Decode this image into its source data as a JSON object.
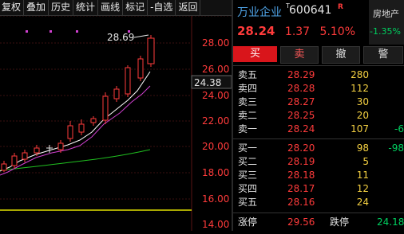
{
  "toolbar": {
    "items": [
      "复权",
      "叠加",
      "历史",
      "统计",
      "画线",
      "标记",
      "-自选",
      "返回"
    ]
  },
  "chart_data": {
    "type": "candlestick",
    "y_ticks": [
      "28.00",
      "26.00",
      "24.00",
      "22.00",
      "20.00",
      "18.00",
      "16.00",
      "14.00"
    ],
    "current_price_label": "24.38",
    "high_annotation": "28.69",
    "colors": {
      "up": "#ff3b3b",
      "down": "#00d060",
      "ma5": "#ffffff",
      "ma10": "#d040d0",
      "ma30": "#20c020",
      "hline": "#e0e000"
    }
  },
  "quote": {
    "name": "万业企业",
    "t_badge": "T",
    "code": "600641",
    "r_badge": "R",
    "sector": "房地产",
    "sector_change": "-1.35%",
    "price": "28.24",
    "change": "1.37",
    "change_pct": "5.10%"
  },
  "actions": {
    "buy": "买",
    "sell": "卖",
    "cancel": "撤",
    "alert": "警"
  },
  "asks": [
    {
      "label": "卖五",
      "price": "28.29",
      "volume": "280",
      "chg": ""
    },
    {
      "label": "卖四",
      "price": "28.28",
      "volume": "112",
      "chg": ""
    },
    {
      "label": "卖三",
      "price": "28.27",
      "volume": "30",
      "chg": ""
    },
    {
      "label": "卖二",
      "price": "28.25",
      "volume": "20",
      "chg": ""
    },
    {
      "label": "卖一",
      "price": "28.24",
      "volume": "107",
      "chg": "-6"
    }
  ],
  "bids": [
    {
      "label": "买一",
      "price": "28.20",
      "volume": "98",
      "chg": "-98"
    },
    {
      "label": "买二",
      "price": "28.19",
      "volume": "5",
      "chg": ""
    },
    {
      "label": "买三",
      "price": "28.18",
      "volume": "11",
      "chg": ""
    },
    {
      "label": "买四",
      "price": "28.17",
      "volume": "12",
      "chg": ""
    },
    {
      "label": "买五",
      "price": "28.16",
      "volume": "24",
      "chg": ""
    }
  ],
  "limits": {
    "up_label": "涨停",
    "up_value": "29.56",
    "down_label": "跌停",
    "down_value": "24.18"
  }
}
